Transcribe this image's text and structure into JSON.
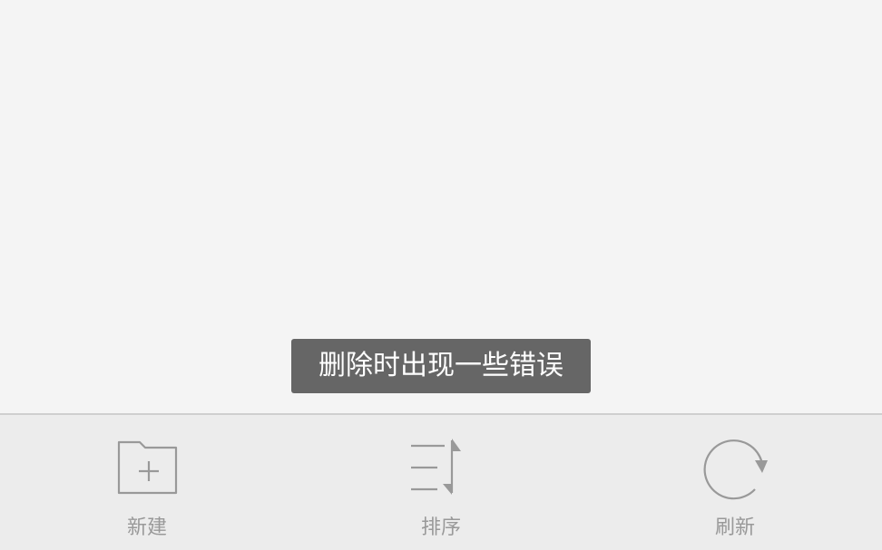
{
  "toast": {
    "message": "删除时出现一些错误"
  },
  "toolbar": {
    "new_label": "新建",
    "sort_label": "排序",
    "refresh_label": "刷新",
    "icon_color": "#999999"
  },
  "icons": {
    "new": "folder-plus-icon",
    "sort": "sort-icon",
    "refresh": "refresh-icon"
  }
}
